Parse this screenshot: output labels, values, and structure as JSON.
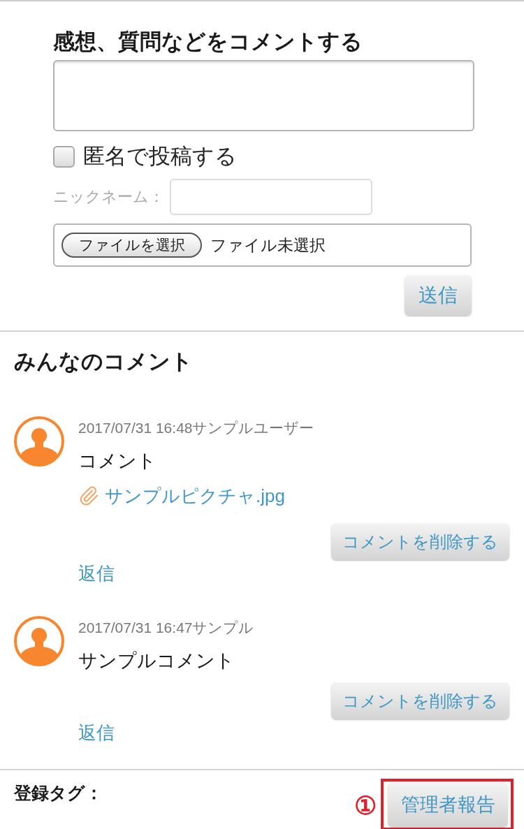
{
  "comment_form": {
    "heading": "感想、質問などをコメントする",
    "anonymous": {
      "label": "匿名で投稿する",
      "checked": false
    },
    "nickname": {
      "label": "ニックネーム："
    },
    "file": {
      "button": "ファイルを選択",
      "status": "ファイル未選択"
    },
    "submit": "送信"
  },
  "comments_section": {
    "heading": "みんなのコメント",
    "comments": [
      {
        "byline": "2017/07/31 16:48サンプルユーザー",
        "text": "コメント",
        "attachment": "サンプルピクチャ.jpg",
        "delete": "コメントを削除する",
        "reply": "返信"
      },
      {
        "byline": "2017/07/31 16:47サンプル",
        "text": "サンプルコメント",
        "delete": "コメントを削除する",
        "reply": "返信"
      }
    ]
  },
  "footer": {
    "tags_label": "登録タグ：",
    "report_button": "管理者報告",
    "annotation": {
      "marker": "①",
      "highlighted": true
    }
  }
}
